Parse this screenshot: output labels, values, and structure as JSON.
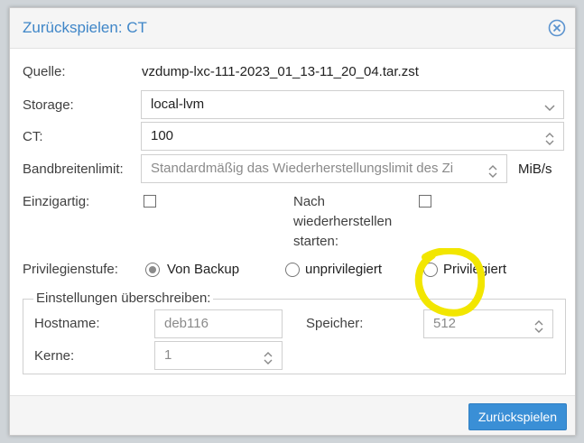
{
  "dialog": {
    "title": "Zurückspielen: CT"
  },
  "form": {
    "source_label": "Quelle:",
    "source_value": "vzdump-lxc-111-2023_01_13-11_20_04.tar.zst",
    "storage_label": "Storage:",
    "storage_value": "local-lvm",
    "ct_label": "CT:",
    "ct_value": "100",
    "bandwidth_label": "Bandbreitenlimit:",
    "bandwidth_placeholder": "Standardmäßig das Wiederherstellungslimit des Zi",
    "bandwidth_unit": "MiB/s",
    "unique_label": "Einzigartig:",
    "start_after_label_line1": "Nach",
    "start_after_label_line2": "wiederherstellen",
    "start_after_label_line3": "starten:",
    "privilege_label": "Privilegienstufe:",
    "privilege_options": [
      "Von Backup",
      "unprivilegiert",
      "Privilegiert"
    ],
    "privilege_selected": "Von Backup"
  },
  "override": {
    "legend": "Einstellungen überschreiben:",
    "hostname_label": "Hostname:",
    "hostname_placeholder": "deb116",
    "memory_label": "Speicher:",
    "memory_placeholder": "512",
    "cores_label": "Kerne:",
    "cores_placeholder": "1"
  },
  "footer": {
    "restore_button": "Zurückspielen"
  },
  "colors": {
    "title": "#3f86c8",
    "primary": "#3a8fd6",
    "highlight": "#f2e600"
  }
}
